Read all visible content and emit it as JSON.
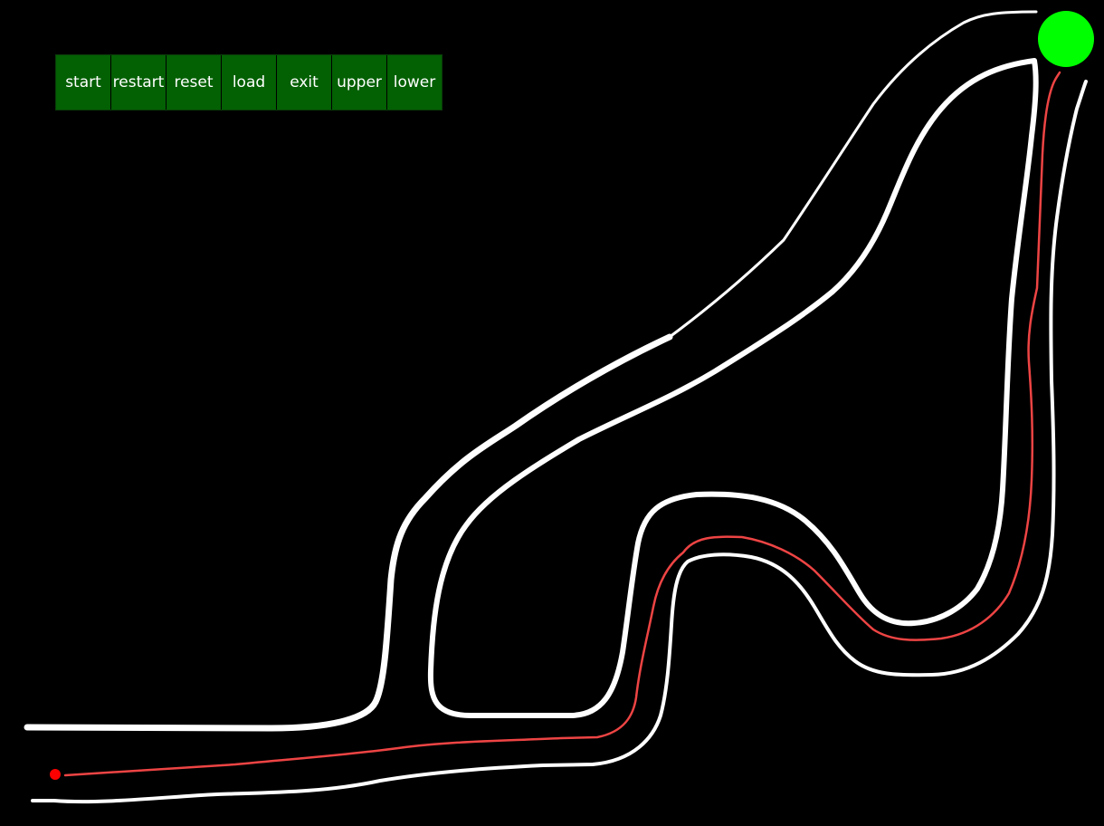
{
  "toolbar": {
    "buttons": [
      {
        "id": "start",
        "label": "start"
      },
      {
        "id": "restart",
        "label": "restart"
      },
      {
        "id": "reset",
        "label": "reset"
      },
      {
        "id": "load",
        "label": "load"
      },
      {
        "id": "exit",
        "label": "exit"
      },
      {
        "id": "upper",
        "label": "upper"
      },
      {
        "id": "lower",
        "label": "lower"
      }
    ]
  },
  "colors": {
    "background": "#000000",
    "button": "#036003",
    "button_text": "#ffffff",
    "track_wall": "#ffffff",
    "agent_path": "#ee4444",
    "start_marker": "#ff0000",
    "goal_marker": "#00ff00"
  },
  "markers": {
    "start": {
      "color": "red",
      "shape": "small-dot"
    },
    "goal": {
      "color": "green",
      "shape": "large-circle"
    }
  }
}
